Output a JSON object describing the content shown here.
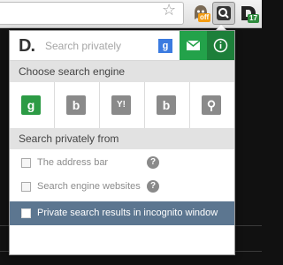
{
  "popup": {
    "search": {
      "logo_text": "D.",
      "placeholder": "Search privately",
      "engine_badge": "g"
    },
    "engines_section": {
      "title": "Choose search engine",
      "engines": [
        {
          "name": "google",
          "glyph": "g",
          "color": "#2c9b45"
        },
        {
          "name": "bing",
          "glyph": "b",
          "color": "#888888"
        },
        {
          "name": "yahoo",
          "glyph": "Y!",
          "color": "#888888"
        },
        {
          "name": "blekko",
          "glyph": "b",
          "color": "#888888"
        },
        {
          "name": "other",
          "glyph": "⚲",
          "color": "#888888"
        }
      ]
    },
    "privacy_section": {
      "title": "Search privately from",
      "options": [
        {
          "label": "The address bar",
          "help": "?"
        },
        {
          "label": "Search engine websites",
          "help": "?"
        }
      ],
      "incognito_label": "Private search results in incognito window"
    }
  },
  "toolbar": {
    "ghost_badge": "off",
    "d_badge": "17"
  },
  "colors": {
    "accent_green": "#23a24a",
    "dark_green": "#1d7f3a",
    "incognito_bg": "#5c7690"
  }
}
